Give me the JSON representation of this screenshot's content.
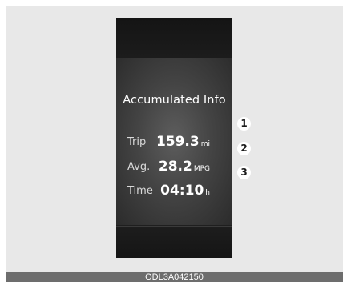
{
  "screen": {
    "title": "Accumulated Info",
    "rows": [
      {
        "label": "Trip",
        "value": "159.3",
        "unit": "mi",
        "callout": "1"
      },
      {
        "label": "Avg.",
        "value": "28.2",
        "unit": "MPG",
        "callout": "2"
      },
      {
        "label": "Time",
        "value": "04:10",
        "unit": "h",
        "callout": "3"
      }
    ]
  },
  "caption": "ODL3A042150"
}
